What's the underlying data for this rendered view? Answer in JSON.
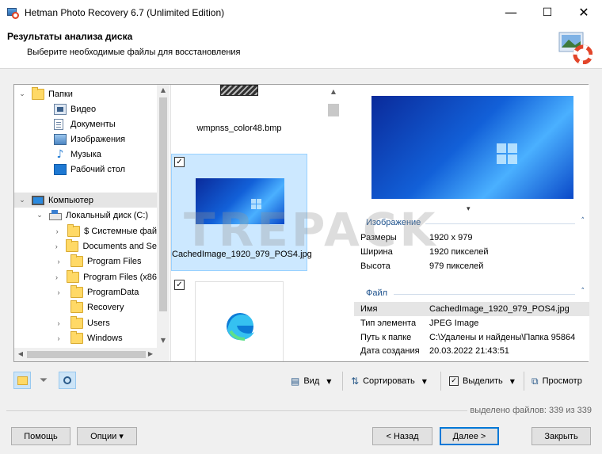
{
  "window": {
    "title": "Hetman Photo Recovery 6.7 (Unlimited Edition)",
    "minimize": "—",
    "maximize": "☐",
    "close": "✕"
  },
  "header": {
    "title": "Результаты анализа диска",
    "subtitle": "Выберите необходимые файлы для восстановления",
    "logo_icon": "disk-lifebuoy-logo-icon"
  },
  "tree": {
    "items": [
      {
        "label": "Папки",
        "icon": "folder-icon",
        "arrow": "⌄"
      },
      {
        "label": "Видео",
        "icon": "video-icon",
        "arrow": ""
      },
      {
        "label": "Документы",
        "icon": "documents-icon",
        "arrow": ""
      },
      {
        "label": "Изображения",
        "icon": "images-icon",
        "arrow": ""
      },
      {
        "label": "Музыка",
        "icon": "music-icon",
        "arrow": ""
      },
      {
        "label": "Рабочий стол",
        "icon": "desktop-icon",
        "arrow": ""
      },
      {
        "label": "Компьютер",
        "icon": "computer-icon",
        "arrow": "⌄"
      },
      {
        "label": "Локальный диск (C:)",
        "icon": "disk-icon",
        "arrow": "⌄"
      },
      {
        "label": "$ Системные фай",
        "icon": "folder-icon",
        "arrow": "›"
      },
      {
        "label": "Documents and Se",
        "icon": "folder-icon",
        "arrow": "›"
      },
      {
        "label": "Program Files",
        "icon": "folder-icon",
        "arrow": "›"
      },
      {
        "label": "Program Files (x86",
        "icon": "folder-icon",
        "arrow": "›"
      },
      {
        "label": "ProgramData",
        "icon": "folder-icon",
        "arrow": "›"
      },
      {
        "label": "Recovery",
        "icon": "folder-icon",
        "arrow": ""
      },
      {
        "label": "Users",
        "icon": "folder-icon",
        "arrow": "›"
      },
      {
        "label": "Windows",
        "icon": "folder-icon",
        "arrow": "›"
      }
    ]
  },
  "thumbnails": {
    "items": [
      {
        "name": "wmpnss_color48.bmp",
        "checked": false,
        "selected": false
      },
      {
        "name": "CachedImage_1920_979_POS4.jpg",
        "checked": true,
        "selected": true
      },
      {
        "name": "",
        "checked": true,
        "selected": false
      }
    ],
    "checkmark": "✓"
  },
  "preview": {
    "section_image": "Изображение",
    "image_props": [
      {
        "key": "Размеры",
        "value": "1920 x 979"
      },
      {
        "key": "Ширина",
        "value": "1920 пикселей"
      },
      {
        "key": "Высота",
        "value": "979 пикселей"
      }
    ],
    "section_file": "Файл",
    "file_props": [
      {
        "key": "Имя",
        "value": "CachedImage_1920_979_POS4.jpg"
      },
      {
        "key": "Тип элемента",
        "value": "JPEG Image"
      },
      {
        "key": "Путь к папке",
        "value": "C:\\Удалены и найдены\\Папка 95864"
      },
      {
        "key": "Дата создания",
        "value": "20.03.2022 21:43:51"
      }
    ],
    "collapse_glyph": "˄",
    "expand_glyph": "▾"
  },
  "toolbar": {
    "view": "Вид",
    "sort": "Сортировать",
    "select": "Выделить",
    "preview": "Просмотр"
  },
  "status": "выделено файлов: 339 из 339",
  "buttons": {
    "help": "Помощь",
    "options": "Опции ▾",
    "back": "< Назад",
    "next": "Далее >",
    "close": "Закрыть"
  },
  "watermark": "TREPACK",
  "colors": {
    "accent": "#0078d7",
    "selection": "#cce8ff",
    "section_header": "#1a4f8b"
  }
}
